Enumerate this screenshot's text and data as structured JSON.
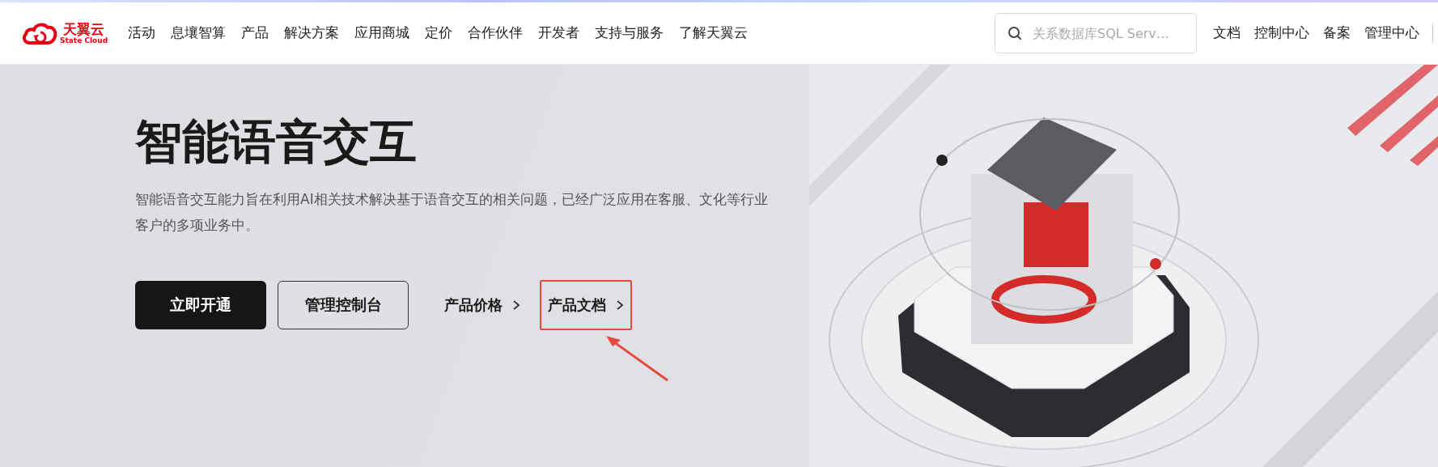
{
  "header": {
    "logo": {
      "name": "天翼云",
      "subtitle": "State Cloud"
    },
    "nav": [
      "活动",
      "息壤智算",
      "产品",
      "解决方案",
      "应用商城",
      "定价",
      "合作伙伴",
      "开发者",
      "支持与服务",
      "了解天翼云"
    ],
    "search": {
      "placeholder": "关系数据库SQL Serv…"
    },
    "links": [
      "文档",
      "控制中心",
      "备案",
      "管理中心"
    ]
  },
  "hero": {
    "title": "智能语音交互",
    "description": "智能语音交互能力旨在利用AI相关技术解决基于语音交互的相关问题，已经广泛应用在客服、文化等行业客户的多项业务中。",
    "buttons": [
      {
        "label": "立即开通",
        "kind": "primary"
      },
      {
        "label": "管理控制台",
        "kind": "outline"
      }
    ],
    "links": [
      {
        "label": "产品价格",
        "highlighted": false
      },
      {
        "label": "产品文档",
        "highlighted": true
      }
    ]
  }
}
